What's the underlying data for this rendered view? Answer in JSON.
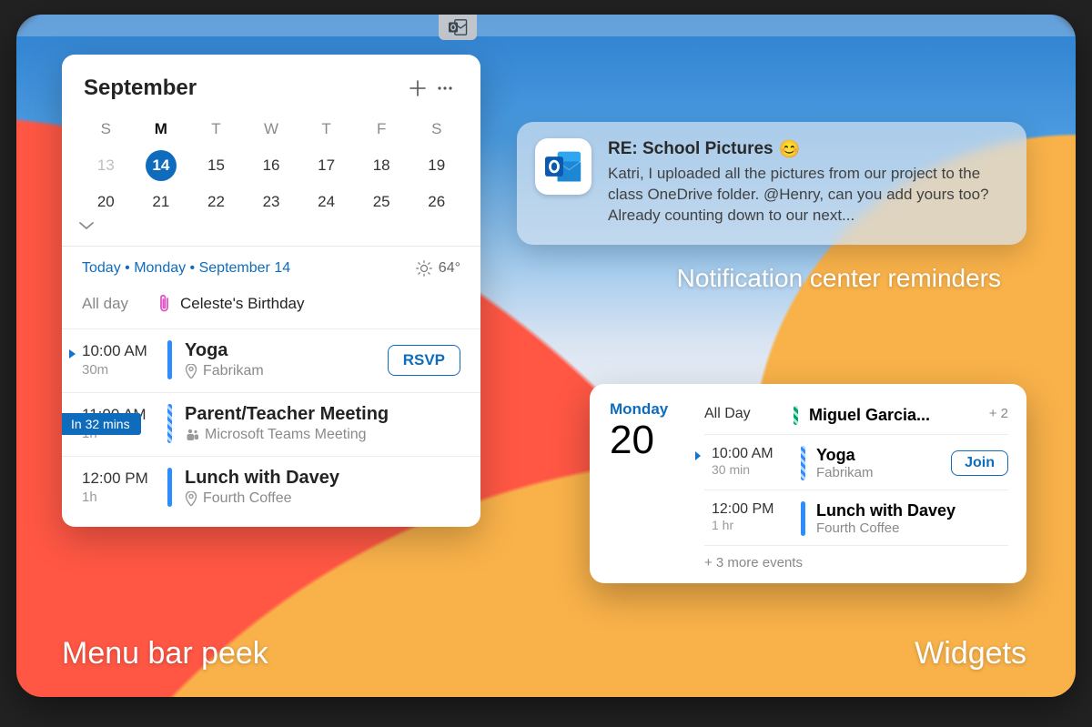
{
  "captions": {
    "menu_peek": "Menu bar peek",
    "widgets": "Widgets",
    "notification": "Notification center reminders"
  },
  "peek": {
    "month": "September",
    "dow": [
      "S",
      "M",
      "T",
      "W",
      "T",
      "F",
      "S"
    ],
    "today_dow_index": 1,
    "rows": [
      [
        {
          "n": "13",
          "faded": true
        },
        {
          "n": "14",
          "selected": true
        },
        {
          "n": "15"
        },
        {
          "n": "16"
        },
        {
          "n": "17"
        },
        {
          "n": "18"
        },
        {
          "n": "19"
        }
      ],
      [
        {
          "n": "20"
        },
        {
          "n": "21"
        },
        {
          "n": "22"
        },
        {
          "n": "23"
        },
        {
          "n": "24"
        },
        {
          "n": "25"
        },
        {
          "n": "26"
        }
      ]
    ],
    "summary_date": "Today • Monday • September 14",
    "weather_temp": "64°",
    "allday_label": "All day",
    "allday_event": "Celeste's Birthday",
    "next_in": "In 32 mins",
    "events": [
      {
        "time": "10:00 AM",
        "dur": "30m",
        "title": "Yoga",
        "sub": "Fabrikam",
        "sub_icon": "location",
        "bar": "blue",
        "rsvp": "RSVP",
        "now": true
      },
      {
        "time": "11:00 AM",
        "dur": "1h",
        "title": "Parent/Teacher Meeting",
        "sub": "Microsoft Teams Meeting",
        "sub_icon": "teams",
        "bar": "hatch-blue"
      },
      {
        "time": "12:00 PM",
        "dur": "1h",
        "title": "Lunch with Davey",
        "sub": "Fourth Coffee",
        "sub_icon": "location",
        "bar": "blue"
      }
    ]
  },
  "notification": {
    "title": "RE: School Pictures",
    "emoji": "😊",
    "body": "Katri, I uploaded all the pictures from our project to the class OneDrive folder. @Henry, can you add yours too? Already counting down to our next..."
  },
  "widget": {
    "dow": "Monday",
    "daynum": "20",
    "allday_label": "All Day",
    "allday_title": "Miguel Garcia...",
    "allday_more": "+ 2",
    "events": [
      {
        "time": "10:00 AM",
        "dur": "30 min",
        "title": "Yoga",
        "sub": "Fabrikam",
        "bar": "hatch-blue",
        "join": "Join",
        "now": true
      },
      {
        "time": "12:00 PM",
        "dur": "1 hr",
        "title": "Lunch with Davey",
        "sub": "Fourth Coffee",
        "bar": "blue"
      }
    ],
    "more_events": "+ 3 more events"
  }
}
